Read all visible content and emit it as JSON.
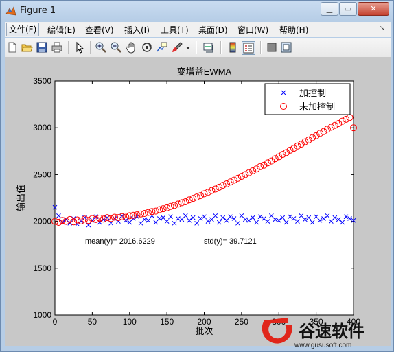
{
  "window": {
    "title": "Figure 1",
    "buttons": {
      "minimize": "▁",
      "maximize": "▭",
      "close": "✕"
    }
  },
  "menubar": {
    "items": [
      "文件(F)",
      "编辑(E)",
      "查看(V)",
      "插入(I)",
      "工具(T)",
      "桌面(D)",
      "窗口(W)",
      "帮助(H)"
    ],
    "overflow_arrow": "↘"
  },
  "toolbar": {
    "icons": [
      "new-figure-icon",
      "open-file-icon",
      "save-icon",
      "print-icon",
      "pointer-icon",
      "zoom-in-icon",
      "zoom-out-icon",
      "pan-icon",
      "rotate-3d-icon",
      "data-cursor-icon",
      "brush-icon",
      "link-plot-icon",
      "colorbar-icon",
      "legend-icon",
      "hide-plot-tools-icon",
      "show-plot-tools-icon"
    ]
  },
  "chart_data": {
    "type": "scatter",
    "title": "变增益EWMA",
    "xlabel": "批次",
    "ylabel": "输出值",
    "xlim": [
      0,
      400
    ],
    "ylim": [
      1000,
      3500
    ],
    "xticks": [
      0,
      50,
      100,
      150,
      200,
      250,
      300,
      350,
      400
    ],
    "yticks": [
      1000,
      1500,
      2000,
      2500,
      3000,
      3500
    ],
    "grid": false,
    "legend_position": "top-right",
    "annotations": {
      "mean_label": "mean(y)=",
      "mean_value": "2016.6229",
      "std_label": "std(y)=",
      "std_value": "39.7121"
    },
    "series": [
      {
        "name": "加控制",
        "marker": "x",
        "color": "#0000ff",
        "x": [
          0,
          5,
          10,
          15,
          20,
          25,
          30,
          35,
          40,
          45,
          50,
          55,
          60,
          65,
          70,
          75,
          80,
          85,
          90,
          95,
          100,
          105,
          110,
          115,
          120,
          125,
          130,
          135,
          140,
          145,
          150,
          155,
          160,
          165,
          170,
          175,
          180,
          185,
          190,
          195,
          200,
          205,
          210,
          215,
          220,
          225,
          230,
          235,
          240,
          245,
          250,
          255,
          260,
          265,
          270,
          275,
          280,
          285,
          290,
          295,
          300,
          305,
          310,
          315,
          320,
          325,
          330,
          335,
          340,
          345,
          350,
          355,
          360,
          365,
          370,
          375,
          380,
          385,
          390,
          395,
          400
        ],
        "y": [
          2150,
          2060,
          1990,
          2020,
          1980,
          2030,
          1970,
          2000,
          2040,
          1960,
          2010,
          2050,
          1990,
          2020,
          2040,
          1980,
          2030,
          2000,
          2060,
          2010,
          1990,
          2030,
          2050,
          1980,
          2020,
          2010,
          2060,
          1990,
          2030,
          2040,
          2000,
          2050,
          1980,
          2030,
          2020,
          2060,
          2010,
          2040,
          1980,
          2030,
          2050,
          2000,
          2020,
          2060,
          1990,
          2040,
          2010,
          2050,
          2030,
          1980,
          2060,
          2020,
          2010,
          2040,
          1990,
          2050,
          2030,
          2000,
          2060,
          2020,
          2010,
          2040,
          1990,
          2050,
          2030,
          2000,
          2060,
          2020,
          2040,
          1990,
          2050,
          2010,
          2030,
          2060,
          2000,
          2040,
          2020,
          1990,
          2050,
          2030,
          2010
        ]
      },
      {
        "name": "未加控制",
        "marker": "o",
        "color": "#ff0000",
        "x": [
          0,
          5,
          10,
          15,
          20,
          25,
          30,
          35,
          40,
          45,
          50,
          55,
          60,
          65,
          70,
          75,
          80,
          85,
          90,
          95,
          100,
          105,
          110,
          115,
          120,
          125,
          130,
          135,
          140,
          145,
          150,
          155,
          160,
          165,
          170,
          175,
          180,
          185,
          190,
          195,
          200,
          205,
          210,
          215,
          220,
          225,
          230,
          235,
          240,
          245,
          250,
          255,
          260,
          265,
          270,
          275,
          280,
          285,
          290,
          295,
          300,
          305,
          310,
          315,
          320,
          325,
          330,
          335,
          340,
          345,
          350,
          355,
          360,
          365,
          370,
          375,
          380,
          385,
          390,
          395,
          400
        ],
        "y": [
          2000,
          1990,
          2010,
          2000,
          2020,
          1995,
          2015,
          2005,
          2025,
          2010,
          2030,
          2020,
          2035,
          2025,
          2040,
          2030,
          2045,
          2040,
          2050,
          2045,
          2060,
          2065,
          2070,
          2080,
          2085,
          2095,
          2105,
          2110,
          2125,
          2135,
          2145,
          2160,
          2170,
          2185,
          2200,
          2210,
          2230,
          2245,
          2260,
          2275,
          2295,
          2310,
          2330,
          2345,
          2365,
          2385,
          2400,
          2420,
          2440,
          2460,
          2480,
          2500,
          2520,
          2540,
          2560,
          2585,
          2600,
          2625,
          2645,
          2670,
          2690,
          2715,
          2735,
          2760,
          2780,
          2805,
          2825,
          2850,
          2870,
          2895,
          2915,
          2940,
          2960,
          2985,
          3005,
          3025,
          3045,
          3070,
          3090,
          3110,
          3000
        ]
      }
    ]
  },
  "watermark": {
    "brand": "谷速软件",
    "url": "www.gususoft.com"
  }
}
